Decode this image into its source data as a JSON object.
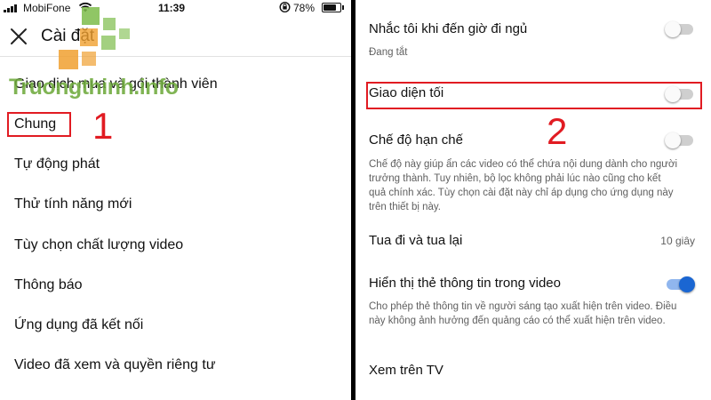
{
  "status_bar": {
    "carrier": "MobiFone",
    "time": "11:39",
    "battery_pct": "78%",
    "battery_level": 0.78,
    "icons": [
      "signal-icon",
      "wifi-icon",
      "rotation-lock-icon",
      "battery-icon"
    ]
  },
  "left": {
    "header": {
      "title": "Cài đặt",
      "close_icon": "close-icon"
    },
    "watermark": "Truongthinh.info",
    "items": [
      "Giao dịch mua và gói thành viên",
      "Chung",
      "Tự động phát",
      "Thử tính năng mới",
      "Tùy chọn chất lượng video",
      "Thông báo",
      "Ứng dụng đã kết nối",
      "Video đã xem và quyền riêng tư"
    ],
    "step_label": "1"
  },
  "right": {
    "settings": [
      {
        "title": "Nhắc tôi khi đến giờ đi ngủ",
        "subtitle": "Đang tắt",
        "toggle": false
      },
      {
        "title": "Giao diện tối",
        "toggle": false
      },
      {
        "title": "Chế độ hạn chế",
        "description": "Chế độ này giúp ẩn các video có thể chứa nội dung dành cho người trưởng thành. Tuy nhiên, bộ lọc không phải lúc nào cũng cho kết quả chính xác. Tùy chọn cài đặt này chỉ áp dụng cho ứng dụng này trên thiết bị này.",
        "toggle": false
      },
      {
        "title": "Tua đi và tua lại",
        "value": "10 giây"
      },
      {
        "title": "Hiển thị thẻ thông tin trong video",
        "description": "Cho phép thẻ thông tin về người sáng tạo xuất hiện trên video. Điều này không ảnh hưởng đến quảng cáo có thể xuất hiện trên video.",
        "toggle": true
      },
      {
        "title": "Xem trên TV"
      }
    ],
    "step_label": "2"
  },
  "colors": {
    "annotation_red": "#e11b22",
    "toggle_on": "#1a66d2",
    "toggle_off": "#cfcfcf",
    "watermark_green": "#6eaa3c",
    "watermark_orange": "#f0a030"
  }
}
